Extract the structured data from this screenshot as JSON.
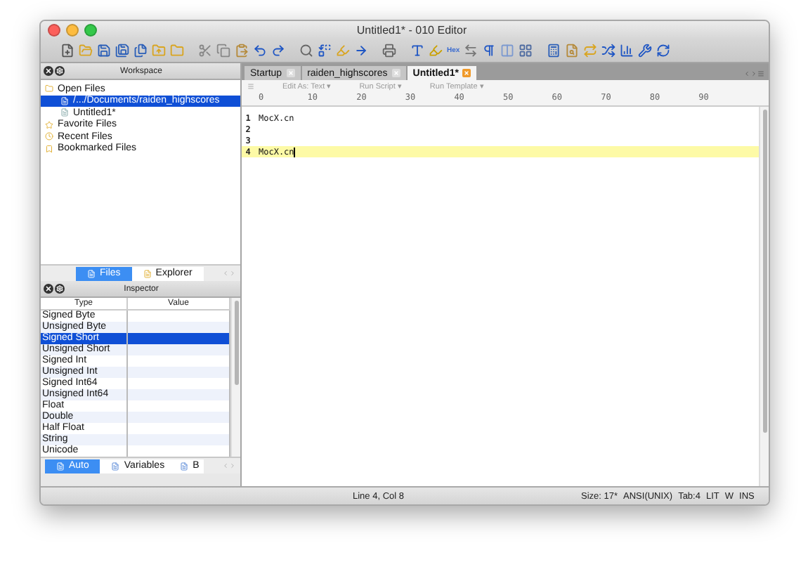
{
  "window": {
    "title": "Untitled1* - 010 Editor"
  },
  "toolbar": {
    "hex_label": "Hex"
  },
  "workspace": {
    "title": "Workspace",
    "tree": [
      {
        "label": "Open Files",
        "selected": false,
        "children": [
          {
            "label": "/.../Documents/raiden_highscores",
            "selected": true
          },
          {
            "label": "Untitled1*",
            "selected": false
          }
        ]
      },
      {
        "label": "Favorite Files",
        "selected": false
      },
      {
        "label": "Recent Files",
        "selected": false
      },
      {
        "label": "Bookmarked Files",
        "selected": false
      }
    ],
    "tabs": [
      {
        "label": "Files",
        "selected": true
      },
      {
        "label": "Explorer",
        "selected": false
      }
    ]
  },
  "inspector": {
    "title": "Inspector",
    "columns": [
      "Type",
      "Value"
    ],
    "rows": [
      {
        "type": "Signed Byte",
        "selected": false
      },
      {
        "type": "Unsigned Byte",
        "selected": false
      },
      {
        "type": "Signed Short",
        "selected": true
      },
      {
        "type": "Unsigned Short",
        "selected": false
      },
      {
        "type": "Signed Int",
        "selected": false
      },
      {
        "type": "Unsigned Int",
        "selected": false
      },
      {
        "type": "Signed Int64",
        "selected": false
      },
      {
        "type": "Unsigned Int64",
        "selected": false
      },
      {
        "type": "Float",
        "selected": false
      },
      {
        "type": "Double",
        "selected": false
      },
      {
        "type": "Half Float",
        "selected": false
      },
      {
        "type": "String",
        "selected": false
      },
      {
        "type": "Unicode",
        "selected": false
      }
    ],
    "tabs": [
      {
        "label": "Auto",
        "selected": true
      },
      {
        "label": "Variables",
        "selected": false
      },
      {
        "label": "B",
        "selected": false
      }
    ]
  },
  "editor": {
    "tabs": [
      {
        "label": "Startup",
        "selected": false
      },
      {
        "label": "raiden_highscores",
        "selected": false
      },
      {
        "label": "Untitled1*",
        "selected": true
      }
    ],
    "menus": [
      "Edit As: Text ▾",
      "Run Script ▾",
      "Run Template ▾"
    ],
    "ruler": [
      "0",
      "10",
      "20",
      "30",
      "40",
      "50",
      "60",
      "70",
      "80",
      "90"
    ],
    "lines": [
      {
        "number": "1",
        "text": "MocX.cn",
        "current": false
      },
      {
        "number": "2",
        "current": false
      },
      {
        "number": "3",
        "current": false
      },
      {
        "number": "4",
        "text": "MocX.cn",
        "current": true
      }
    ]
  },
  "status_bar": {
    "position": "Line 4, Col 8",
    "size": "Size: 17*",
    "encoding": "ANSI(UNIX)",
    "tab": "Tab:4",
    "endian": "LIT",
    "mode_w": "W",
    "insert": "INS"
  }
}
